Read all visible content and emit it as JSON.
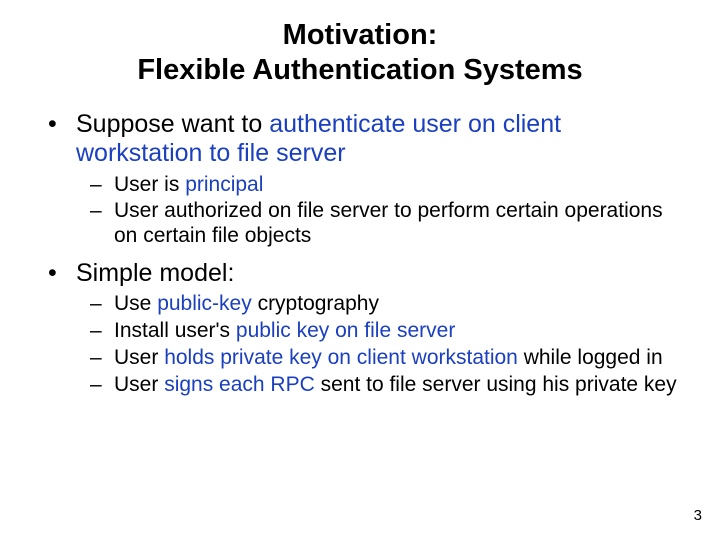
{
  "title": {
    "l1": "Motivation:",
    "l2": "Flexible Authentication Systems"
  },
  "bullets": [
    {
      "runs": [
        {
          "t": "Suppose want to "
        },
        {
          "t": "authenticate user on client workstation to file server",
          "term": true
        }
      ],
      "sub": [
        [
          {
            "t": "User is "
          },
          {
            "t": "principal",
            "term": true
          }
        ],
        [
          {
            "t": "User authorized on file server to perform certain operations on certain file objects"
          }
        ]
      ]
    },
    {
      "runs": [
        {
          "t": "Simple model:"
        }
      ],
      "sub": [
        [
          {
            "t": "Use "
          },
          {
            "t": "public-key",
            "term": true
          },
          {
            "t": " cryptography"
          }
        ],
        [
          {
            "t": "Install user's "
          },
          {
            "t": "public key on file server",
            "term": true
          }
        ],
        [
          {
            "t": "User "
          },
          {
            "t": "holds private key on client workstation",
            "term": true
          },
          {
            "t": " while logged in"
          }
        ],
        [
          {
            "t": "User "
          },
          {
            "t": "signs each RPC",
            "term": true
          },
          {
            "t": " sent to file server using his private key"
          }
        ]
      ]
    }
  ],
  "page_number": "3"
}
